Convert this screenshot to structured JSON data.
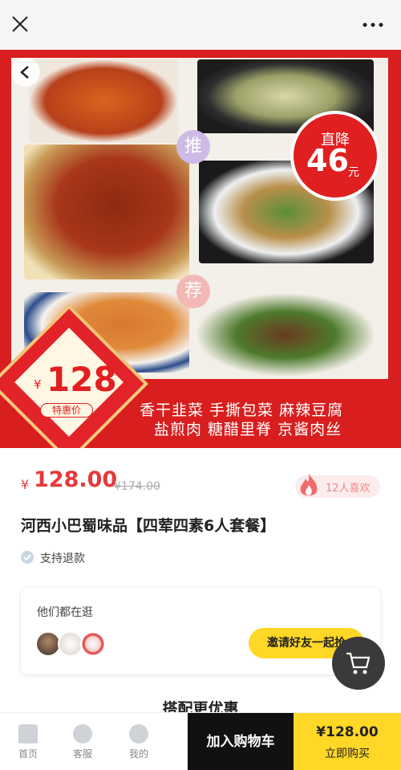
{
  "topbar": {
    "close_icon": "close-icon",
    "more_icon": "more-icon"
  },
  "banner": {
    "discount_label": "直降",
    "discount_value": "46",
    "discount_unit": "元",
    "recommend_char_1": "推",
    "recommend_char_2": "荐",
    "badge_currency": "¥",
    "badge_price": "128",
    "badge_tag": "特惠价",
    "dishes_line_1": "香干韭菜  手撕包菜  麻辣豆腐",
    "dishes_line_2": "盐煎肉  糖醋里脊  京酱肉丝"
  },
  "product": {
    "currency": "¥",
    "price": "128.00",
    "original_price": "¥174.00",
    "likes": "12人喜欢",
    "title": "河西小巴蜀味品【四荤四素6人套餐】",
    "refund": "支持退款"
  },
  "browsing": {
    "heading": "他们都在逛",
    "invite_label": "邀请好友一起抢"
  },
  "section": {
    "title": "搭配更优惠"
  },
  "bottom_nav": {
    "home": "首页",
    "service": "客服",
    "mine": "我的",
    "add_to_cart": "加入购物车",
    "buy_price": "¥128.00",
    "buy_label": "立即购买"
  },
  "colors": {
    "accent": "#e4393c",
    "yellow": "#ffd726",
    "banner_red": "#d81e1e"
  }
}
